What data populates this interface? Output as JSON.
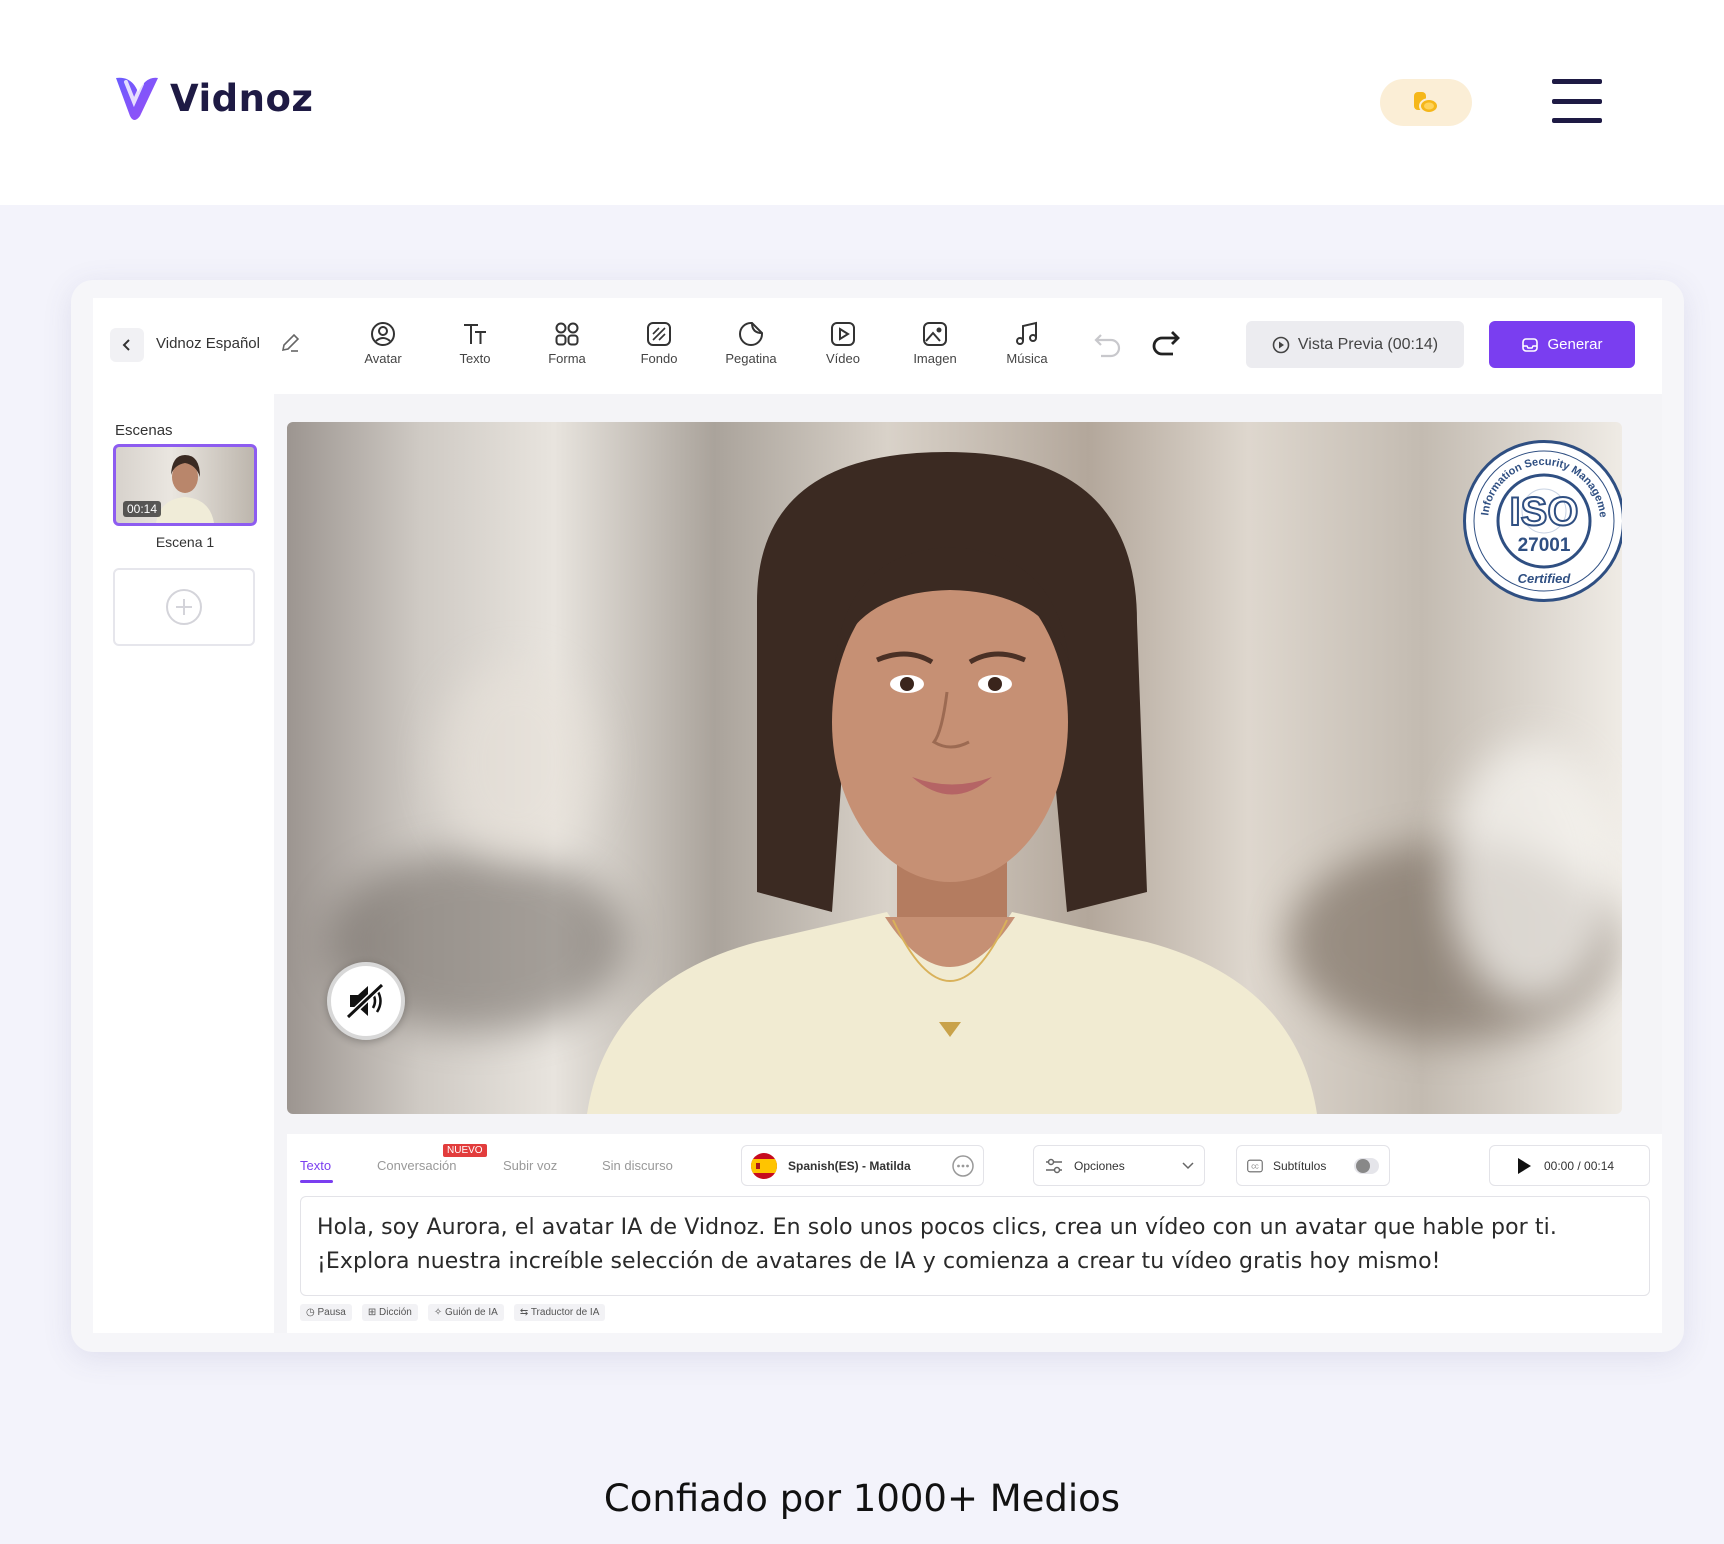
{
  "header": {
    "logo_text": "Vidnoz",
    "menu_icon": "hamburger-menu-icon",
    "coin_icon": "coins-icon"
  },
  "editor": {
    "project_name": "Vidnoz Español",
    "tools": [
      {
        "label": "Avatar",
        "icon": "avatar-icon"
      },
      {
        "label": "Texto",
        "icon": "text-icon"
      },
      {
        "label": "Forma",
        "icon": "shape-icon"
      },
      {
        "label": "Fondo",
        "icon": "background-icon"
      },
      {
        "label": "Pegatina",
        "icon": "sticker-icon"
      },
      {
        "label": "Vídeo",
        "icon": "video-icon"
      },
      {
        "label": "Imagen",
        "icon": "image-icon"
      },
      {
        "label": "Música",
        "icon": "music-icon"
      }
    ],
    "preview_label": "Vista Previa (00:14)",
    "generate_label": "Generar",
    "scenes_title": "Escenas",
    "scene_time": "00:14",
    "scene_label": "Escena 1",
    "iso": {
      "top_text": "Information Security Management System",
      "main": "ISO",
      "number": "27001",
      "bottom": "Certified"
    },
    "tabs": {
      "texto": "Texto",
      "conversacion": "Conversación",
      "subir_voz": "Subir voz",
      "sin_discurso": "Sin discurso",
      "new_badge": "NUEVO"
    },
    "voice": "Spanish(ES) - Matilda",
    "options": "Opciones",
    "subtitles": "Subtítulos",
    "time": "00:00 / 00:14",
    "script": "Hola, soy Aurora, el avatar IA de Vidnoz. En solo unos pocos clics, crea un vídeo con un avatar que hable por ti. ¡Explora nuestra increíble selección de avatares de IA y comienza a crear tu vídeo gratis hoy mismo!",
    "chips": [
      "Pausa",
      "Dicción",
      "Guión de IA",
      "Traductor de IA"
    ]
  },
  "trusted_text": "Confiado por 1000+ Medios",
  "colors": {
    "accent": "#7a3ef0",
    "brand_dark": "#1e1a44",
    "coin_bg": "#fbeed6"
  }
}
